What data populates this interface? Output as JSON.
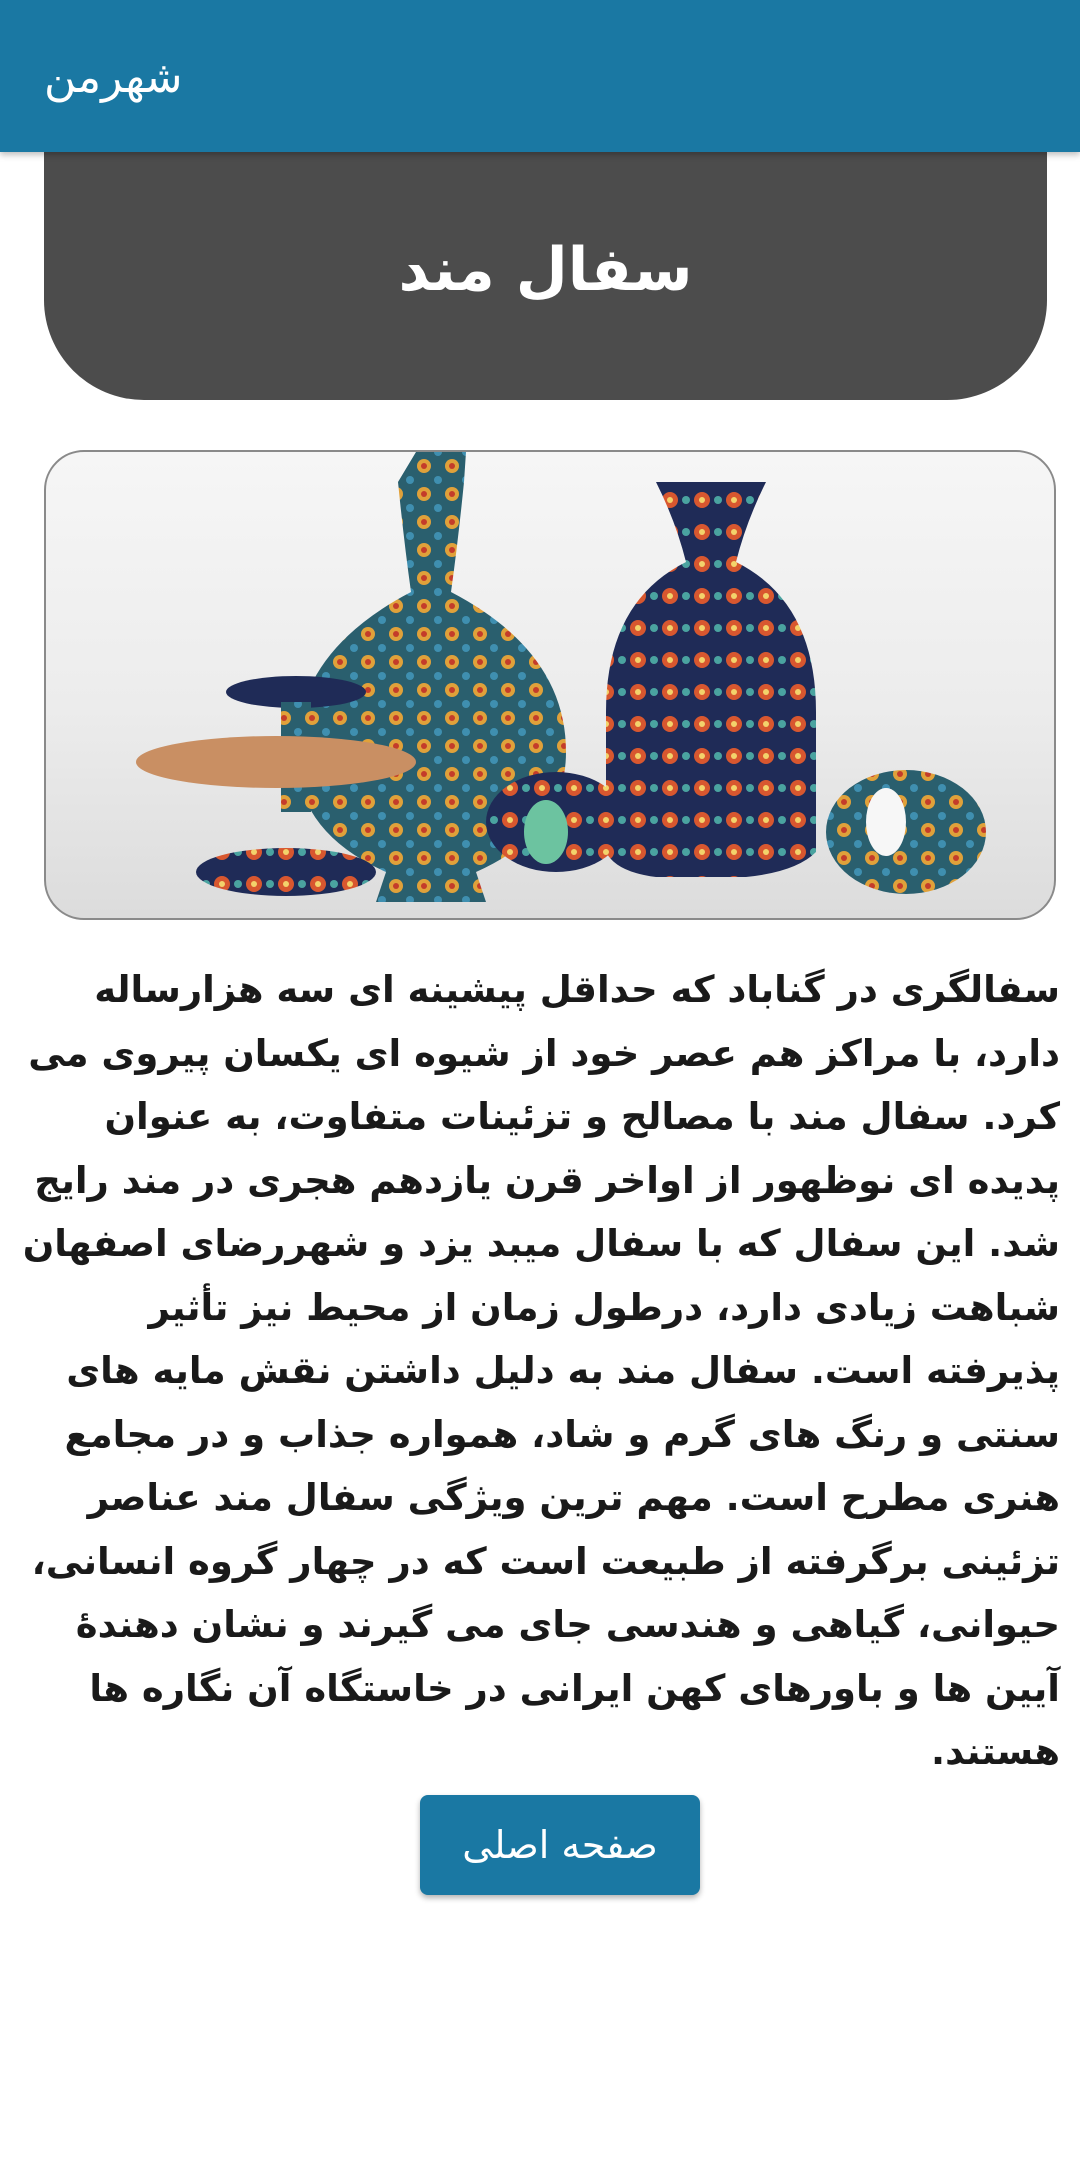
{
  "appbar": {
    "title": "شهرمن"
  },
  "header": {
    "title": "سفال مند"
  },
  "image": {
    "icon": "pottery-photo"
  },
  "article": {
    "body": "سفالگری در گناباد که حداقل پیشینه ای سه هزارساله دارد، با مراکز هم عصر خود از شیوه ای یکسان پیروی می کرد. سفال مند با مصالح و تزئینات متفاوت، به عنوان پدیده ای نوظهور از اواخر قرن یازدهم هجری در مند رایج شد. این سفال که با سفال میبد یزد و شهررضای اصفهان شباهت زیادی دارد، درطول زمان از محیط نیز تأثیر پذیرفته است. سفال مند به دلیل داشتن نقش مایه های سنتی و رنگ های گرم و شاد، همواره جذاب و در مجامع هنری مطرح است. مهم ترین ویژگی سفال مند عناصر تزئینی برگرفته از طبیعت است که در چهار گروه انسانی، حیوانی، گیاهی و هندسی جای می گیرند و نشان دهندۀ آیین ها و باورهای کهن ایرانی در خاستگاه آن نگاره ها هستند."
  },
  "actions": {
    "home_label": "صفحه اصلی"
  },
  "colors": {
    "appbar": "#1a78a3",
    "title_card": "#4c4c4c",
    "button": "#1a78a3"
  }
}
